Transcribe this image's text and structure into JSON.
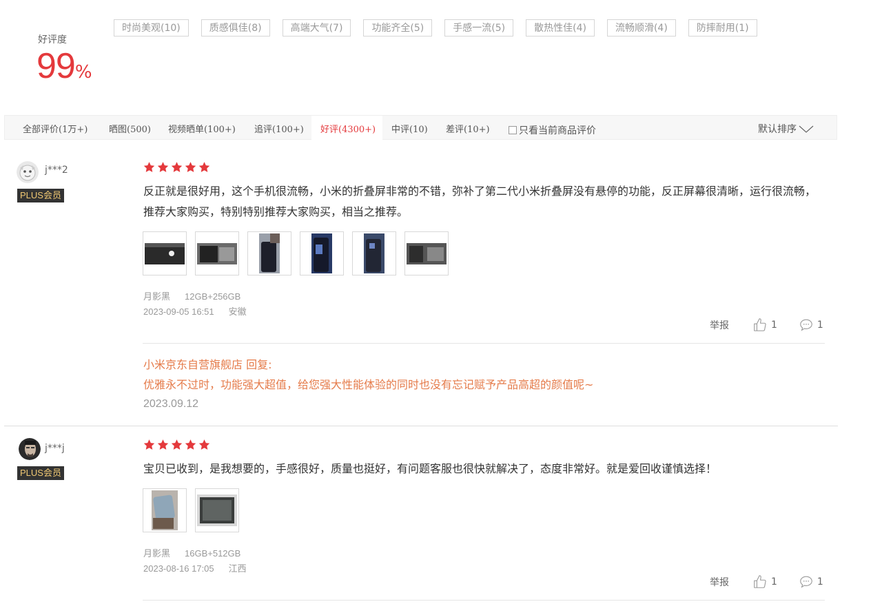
{
  "summary": {
    "label": "好评度",
    "value": "99",
    "unit": "%",
    "tags": [
      "时尚美观(10)",
      "质感俱佳(8)",
      "高端大气(7)",
      "功能齐全(5)",
      "手感一流(5)",
      "散热性佳(4)",
      "流畅顺滑(4)",
      "防摔耐用(1)"
    ]
  },
  "filters": {
    "items": [
      "全部评价(1万+)",
      "晒图(500)",
      "视频晒单(100+)",
      "追评(100+)",
      "好评(4300+)",
      "中评(10)",
      "差评(10+)"
    ],
    "active_index": 4,
    "checkbox_label": "只看当前商品评价",
    "sort_label": "默认排序"
  },
  "comments": [
    {
      "username": "j***2",
      "badge": "PLUS会员",
      "stars": 5,
      "text": "反正就是很好用，这个手机很流畅，小米的折叠屏非常的不错，弥补了第二代小米折叠屏没有悬停的功能，反正屏幕很清晰，运行很流畅，推荐大家购买，特别特别推荐大家购买，相当之推荐。",
      "image_count": 6,
      "color": "月影黑",
      "spec": "12GB+256GB",
      "date": "2023-09-05 16:51",
      "location": "安徽",
      "report": "举报",
      "likes": "1",
      "replies": "1",
      "reply": {
        "title": "小米京东自营旗舰店 回复:",
        "text": "优雅永不过时，功能强大超值，给您强大性能体验的同时也没有忘记赋予产品高超的颜值呢~",
        "date": "2023.09.12"
      }
    },
    {
      "username": "j***j",
      "badge": "PLUS会员",
      "stars": 5,
      "text": "宝贝已收到，是我想要的，手感很好，质量也挺好，有问题客服也很快就解决了，态度非常好。就是爱回收谨慎选择！",
      "image_count": 2,
      "color": "月影黑",
      "spec": "16GB+512GB",
      "date": "2023-08-16 17:05",
      "location": "江西",
      "report": "举报",
      "likes": "1",
      "replies": "1"
    }
  ],
  "colors": {
    "accent": "#e4393c",
    "reply": "#e57b4a",
    "plus_bg": "#333333",
    "plus_text": "#f0c873"
  }
}
